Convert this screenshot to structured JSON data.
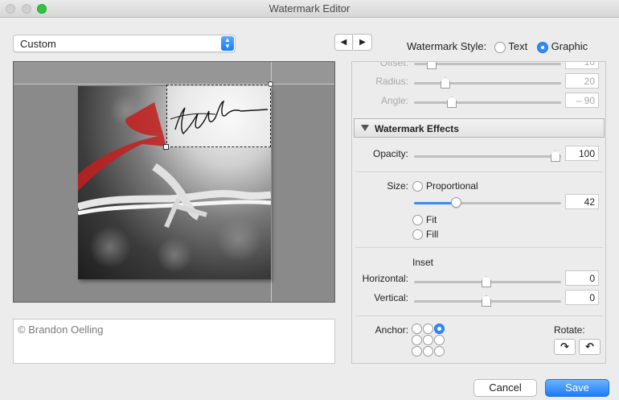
{
  "window": {
    "title": "Watermark Editor"
  },
  "preset": {
    "value": "Custom"
  },
  "nav": {
    "prev_glyph": "◀",
    "next_glyph": "▶"
  },
  "watermark_style": {
    "label": "Watermark Style:",
    "options": [
      {
        "label": "Text",
        "selected": false
      },
      {
        "label": "Graphic",
        "selected": true
      }
    ]
  },
  "caption": {
    "text": "© Brandon Oelling"
  },
  "panel": {
    "partial_rows": [
      {
        "label": "Offset:",
        "value": "10"
      },
      {
        "label": "Radius:",
        "value": "20"
      },
      {
        "label": "Angle:",
        "value": "– 90"
      }
    ],
    "effects_header": "Watermark Effects",
    "opacity": {
      "label": "Opacity:",
      "value": "100",
      "level": 1.0
    },
    "size": {
      "label": "Size:",
      "options": [
        {
          "label": "Proportional",
          "selected": true
        },
        {
          "label": "Fit",
          "selected": false
        },
        {
          "label": "Fill",
          "selected": false
        }
      ],
      "value": "42",
      "level": 0.27
    },
    "inset": {
      "title": "Inset",
      "horizontal": {
        "label": "Horizontal:",
        "value": "0",
        "level": 0.5
      },
      "vertical": {
        "label": "Vertical:",
        "value": "0",
        "level": 0.5
      }
    },
    "anchor": {
      "label": "Anchor:",
      "selected": "top-right"
    },
    "rotate": {
      "label": "Rotate:",
      "cw_glyph": "↷",
      "ccw_glyph": "↶"
    }
  },
  "buttons": {
    "cancel": "Cancel",
    "save": "Save"
  },
  "colors": {
    "accent": "#2f8bf7",
    "save_button": "#1b7df6",
    "window_bg": "#ececec"
  },
  "icons": [
    "close-icon",
    "minimize-icon",
    "zoom-icon",
    "chevron-updown-icon",
    "arrow-left-icon",
    "arrow-right-icon",
    "disclosure-triangle-icon",
    "rotate-clockwise-icon",
    "rotate-counterclockwise-icon"
  ]
}
